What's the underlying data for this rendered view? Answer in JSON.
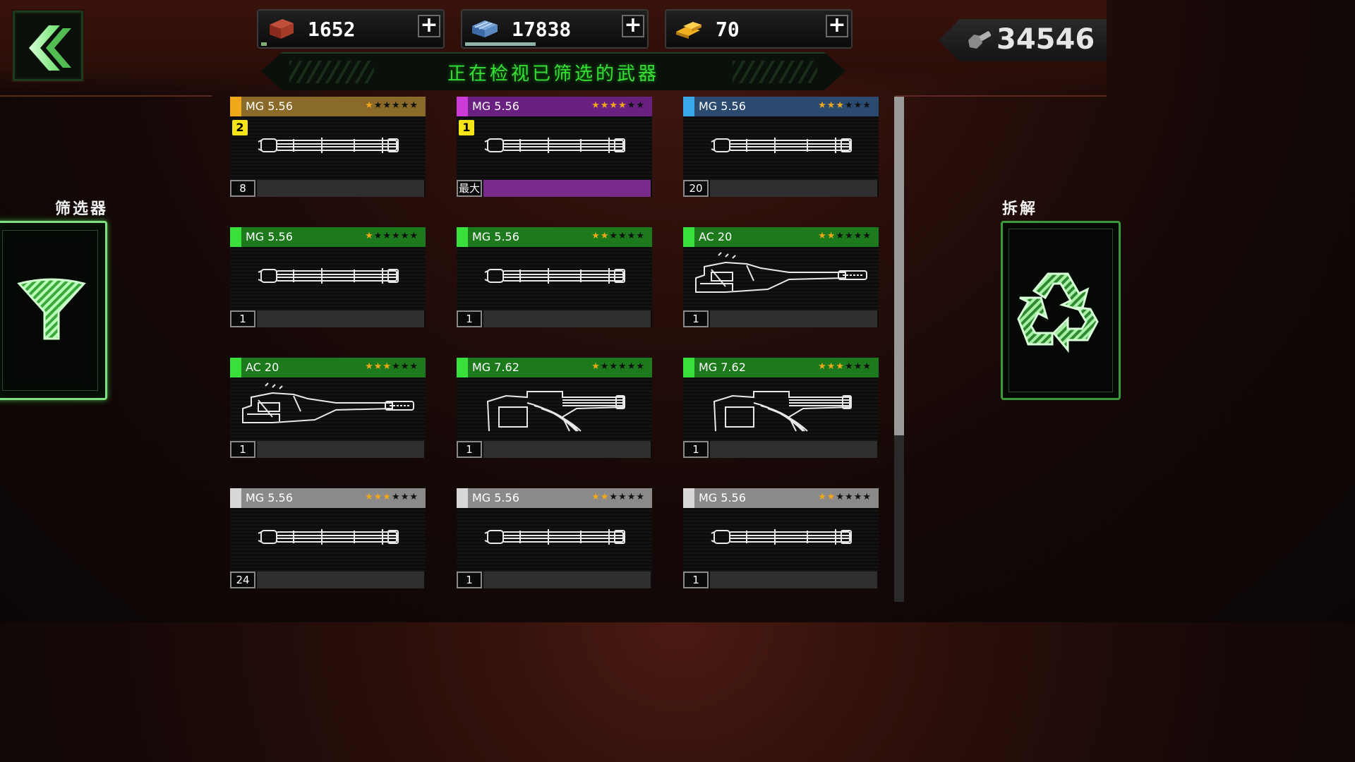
{
  "header": {
    "title": "正在检视已筛选的武器",
    "resources": [
      {
        "icon": "gear-crate-icon",
        "value": "1652",
        "bar": 0.03,
        "bar_color": "#7fb070"
      },
      {
        "icon": "steel-plates-icon",
        "value": "17838",
        "bar": 0.38,
        "bar_color": "#8fb4ac"
      },
      {
        "icon": "gold-bars-icon",
        "value": "70",
        "bar": 0,
        "bar_color": "#7fb070"
      }
    ],
    "plus_label": "+",
    "parts": {
      "icon": "bolt-nut-icon",
      "value": "34546"
    }
  },
  "left_panel": {
    "label": "筛选器",
    "icon": "filter-funnel-icon"
  },
  "right_panel": {
    "label": "拆解",
    "icon": "recycle-icon"
  },
  "accent": "#35e035",
  "weapons": [
    {
      "name": "MG 5.56",
      "rarity_color": "#f0a818",
      "header_color": "#8a6a28",
      "stars": 1,
      "badge": "2",
      "level": "8",
      "progress": 0,
      "progress_color": "#2f2f2f",
      "gun": "minigun"
    },
    {
      "name": "MG 5.56",
      "rarity_color": "#cc3ad8",
      "header_color": "#6a2080",
      "stars": 4,
      "badge": "1",
      "level": "最大",
      "progress": 1,
      "progress_color": "#7a2a8a",
      "gun": "minigun"
    },
    {
      "name": "MG 5.56",
      "rarity_color": "#3aa8e8",
      "header_color": "#2a4a70",
      "stars": 3,
      "badge": null,
      "level": "20",
      "progress": 0,
      "progress_color": "#2f2f2f",
      "gun": "minigun"
    },
    {
      "name": "MG 5.56",
      "rarity_color": "#3ae03a",
      "header_color": "#1c7a1c",
      "stars": 1,
      "badge": null,
      "level": "1",
      "progress": 0,
      "progress_color": "#2f2f2f",
      "gun": "minigun"
    },
    {
      "name": "MG 5.56",
      "rarity_color": "#3ae03a",
      "header_color": "#1c7a1c",
      "stars": 2,
      "badge": null,
      "level": "1",
      "progress": 0,
      "progress_color": "#2f2f2f",
      "gun": "minigun"
    },
    {
      "name": "AC 20",
      "rarity_color": "#3ae03a",
      "header_color": "#1c7a1c",
      "stars": 2,
      "badge": null,
      "level": "1",
      "progress": 0,
      "progress_color": "#2f2f2f",
      "gun": "autocannon"
    },
    {
      "name": "AC 20",
      "rarity_color": "#3ae03a",
      "header_color": "#1c7a1c",
      "stars": 3,
      "badge": null,
      "level": "1",
      "progress": 0,
      "progress_color": "#2f2f2f",
      "gun": "autocannon"
    },
    {
      "name": "MG 7.62",
      "rarity_color": "#3ae03a",
      "header_color": "#1c7a1c",
      "stars": 1,
      "badge": null,
      "level": "1",
      "progress": 0,
      "progress_color": "#2f2f2f",
      "gun": "heavymg"
    },
    {
      "name": "MG 7.62",
      "rarity_color": "#3ae03a",
      "header_color": "#1c7a1c",
      "stars": 3,
      "badge": null,
      "level": "1",
      "progress": 0,
      "progress_color": "#2f2f2f",
      "gun": "heavymg"
    },
    {
      "name": "MG 5.56",
      "rarity_color": "#d8d8d8",
      "header_color": "#8a8a8a",
      "stars": 3,
      "badge": null,
      "level": "24",
      "progress": 0,
      "progress_color": "#2f2f2f",
      "gun": "minigun"
    },
    {
      "name": "MG 5.56",
      "rarity_color": "#d8d8d8",
      "header_color": "#8a8a8a",
      "stars": 2,
      "badge": null,
      "level": "1",
      "progress": 0,
      "progress_color": "#2f2f2f",
      "gun": "minigun"
    },
    {
      "name": "MG 5.56",
      "rarity_color": "#d8d8d8",
      "header_color": "#8a8a8a",
      "stars": 2,
      "badge": null,
      "level": "1",
      "progress": 0,
      "progress_color": "#2f2f2f",
      "gun": "minigun"
    }
  ],
  "scroll": {
    "thumb_fraction": 0.67,
    "position": 0
  }
}
